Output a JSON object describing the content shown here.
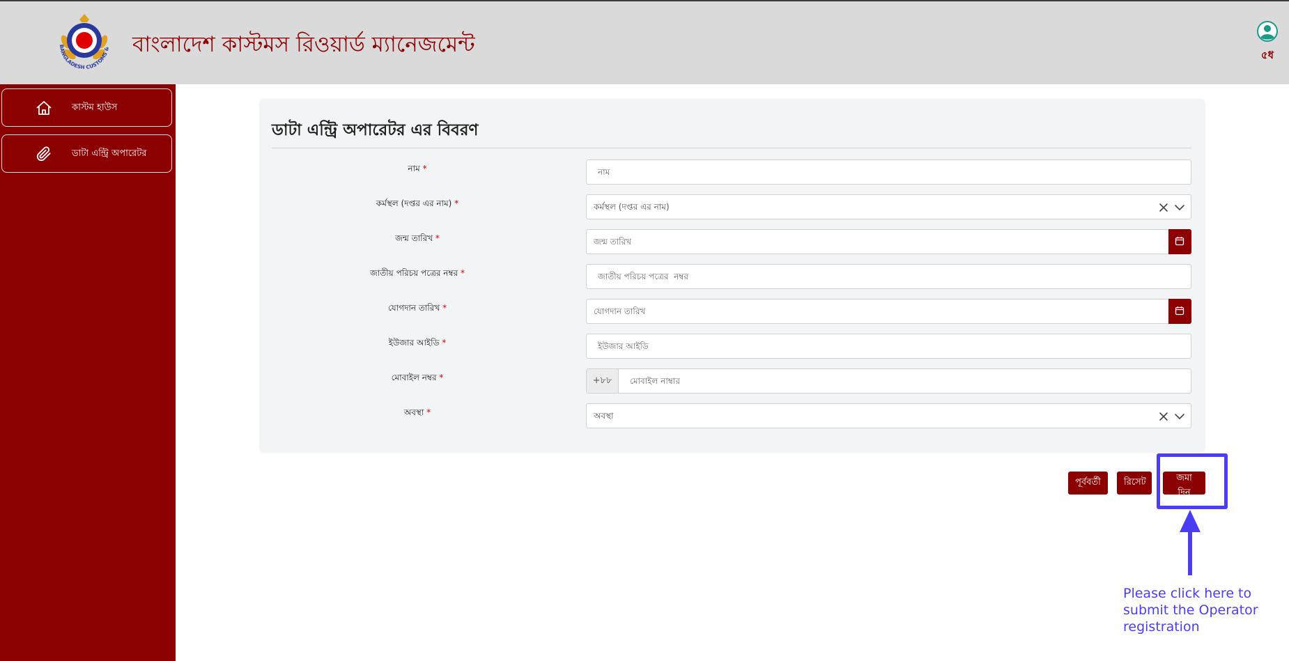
{
  "header": {
    "app_title": "বাংলাদেশ কাস্টমস রিওয়ার্ড ম্যানেজমেন্ট",
    "logo_text": "BANGLADESH CUSTOMS & VAT",
    "user_name": "৫ধ"
  },
  "sidebar": {
    "items": [
      {
        "label": "কাস্টম হাউস",
        "icon": "home-icon"
      },
      {
        "label": "ডাটা এন্ট্রি অপারেটর",
        "icon": "paperclip-icon"
      }
    ]
  },
  "form": {
    "title": "ডাটা এন্ট্রি অপারেটর এর বিবরণ",
    "required_mark": "*",
    "fields": {
      "name": {
        "label": "নাম",
        "placeholder": "নাম"
      },
      "workplace": {
        "label": "কর্মস্থল (দপ্তর এর নাম)",
        "value": "কর্মস্থল (দপ্তর এর নাম)"
      },
      "dob": {
        "label": "জন্ম তারিখ",
        "placeholder": "জন্ম তারিখ"
      },
      "nid": {
        "label": "জাতীয় পরিচয় পত্রের নম্বর",
        "placeholder": "জাতীয় পরিচয় পত্রের  নম্বর"
      },
      "joining_date": {
        "label": "যোগদান তারিখ",
        "placeholder": "যোগদান তারিখ"
      },
      "user_id": {
        "label": "ইউজার আইডি",
        "placeholder": "ইউজার আইডি"
      },
      "mobile": {
        "label": "মোবাইল নম্বর",
        "prefix": "+৮৮",
        "placeholder": "মোবাইল নাম্বার"
      },
      "status": {
        "label": "অবস্থা",
        "value": "অবস্থা"
      }
    }
  },
  "actions": {
    "previous_label": "পূর্ববর্তী",
    "reset_label": "রিসেট",
    "submit_label": "জমা দিন"
  },
  "annotation": {
    "hint_text": "Please click here to submit the Operator registration",
    "color": "#4b3cf5"
  },
  "colors": {
    "brand": "#8b0000",
    "header_bg": "#dadada",
    "card_bg": "#f3f4f5"
  }
}
